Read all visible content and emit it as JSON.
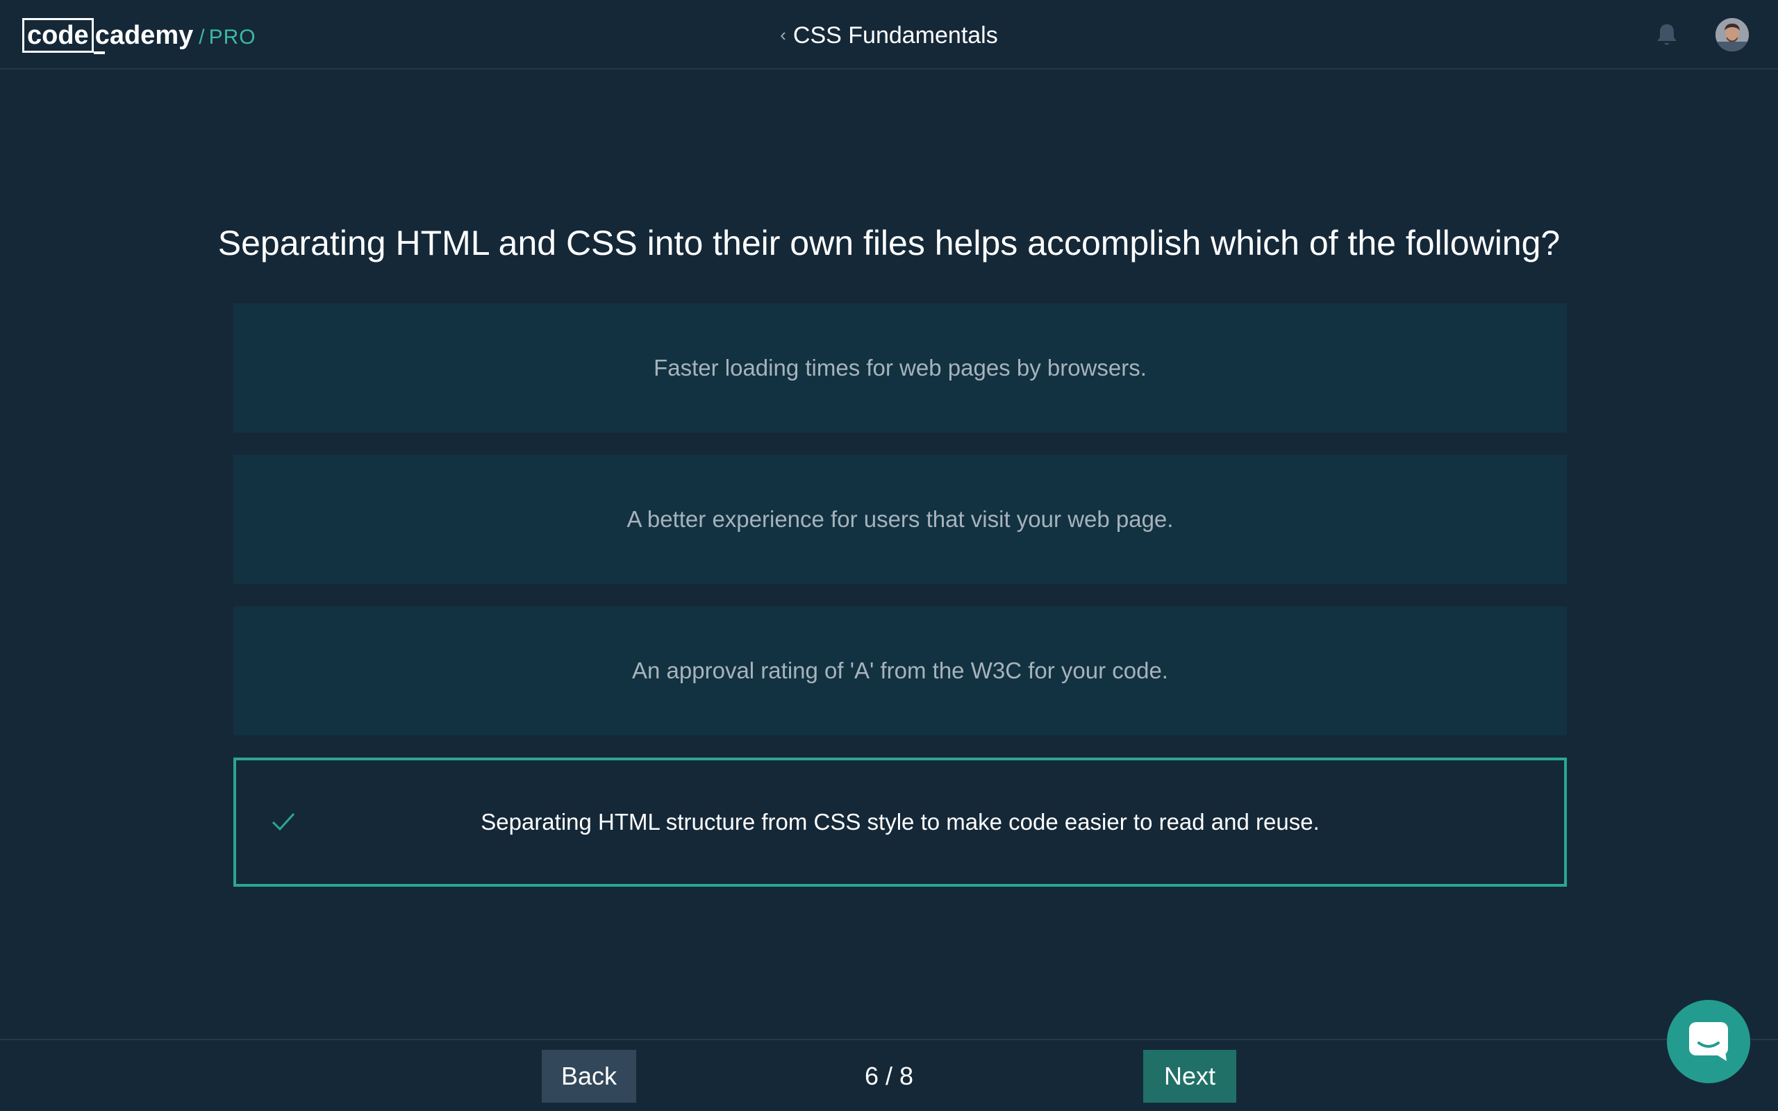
{
  "header": {
    "logo": {
      "box_text": "code",
      "rest_text": "cademy",
      "slash": "/",
      "pro": "PRO"
    },
    "back_chevron": "‹",
    "course_title": "CSS Fundamentals",
    "bell_icon": "bell-icon",
    "avatar_icon": "user-avatar"
  },
  "quiz": {
    "question": "Separating HTML and CSS into their own files helps accomplish which of the following?",
    "options": [
      {
        "label": "Faster loading times for web pages by browsers.",
        "selected": false
      },
      {
        "label": "A better experience for users that visit your web page.",
        "selected": false
      },
      {
        "label": "An approval rating of 'A' from the W3C for your code.",
        "selected": false
      },
      {
        "label": "Separating HTML structure from CSS style to make code easier to read and reuse.",
        "selected": true
      }
    ]
  },
  "footer": {
    "back_label": "Back",
    "progress": "6 / 8",
    "next_label": "Next"
  },
  "colors": {
    "background": "#152838",
    "option_background": "#123242",
    "accent": "#2aa795",
    "next_button": "#207068",
    "back_button": "#32475a"
  }
}
